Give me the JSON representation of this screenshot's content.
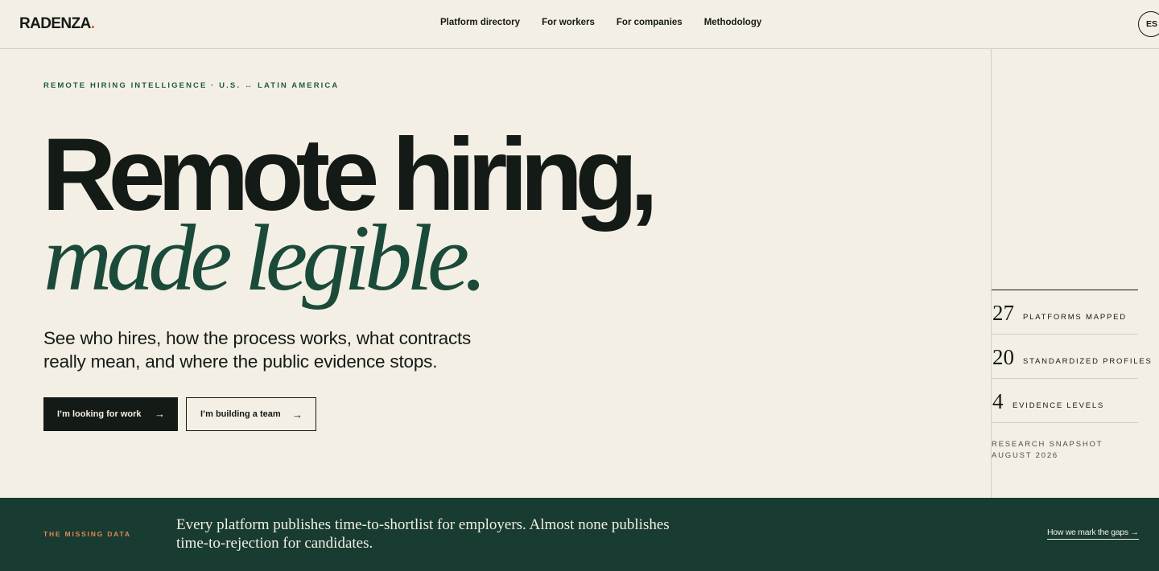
{
  "header": {
    "logo_text": "RADENZA",
    "logo_mark": ".",
    "nav": [
      "Platform directory",
      "For workers",
      "For companies",
      "Methodology"
    ],
    "language": "ES"
  },
  "hero": {
    "eyebrow": "REMOTE HIRING INTELLIGENCE · U.S. ↔ LATIN AMERICA",
    "title_line1": "Remote hiring,",
    "title_line2": "made legible.",
    "subtitle": "See who hires, how the process works, what contracts really mean, and where the public evidence stops.",
    "primary_cta": "I’m looking for work",
    "secondary_cta": "I’m building a team",
    "cta_arrow": "→"
  },
  "stats": [
    {
      "value": "27",
      "label": "PLATFORMS MAPPED"
    },
    {
      "value": "20",
      "label": "STANDARDIZED PROFILES"
    },
    {
      "value": "4",
      "label": "EVIDENCE LEVELS"
    }
  ],
  "snapshot": {
    "line1": "RESEARCH SNAPSHOT",
    "line2": "AUGUST 2026"
  },
  "missing_data": {
    "label": "THE MISSING DATA",
    "text": "Every platform publishes time-to-shortlist for employers. Almost none publishes time-to-rejection for candidates.",
    "link": "How we mark the gaps →"
  },
  "colors": {
    "background": "#f3efe4",
    "ink": "#141a16",
    "accent_green": "#1b4a3a",
    "band": "#183b32",
    "accent_orange": "#e08a4f"
  }
}
